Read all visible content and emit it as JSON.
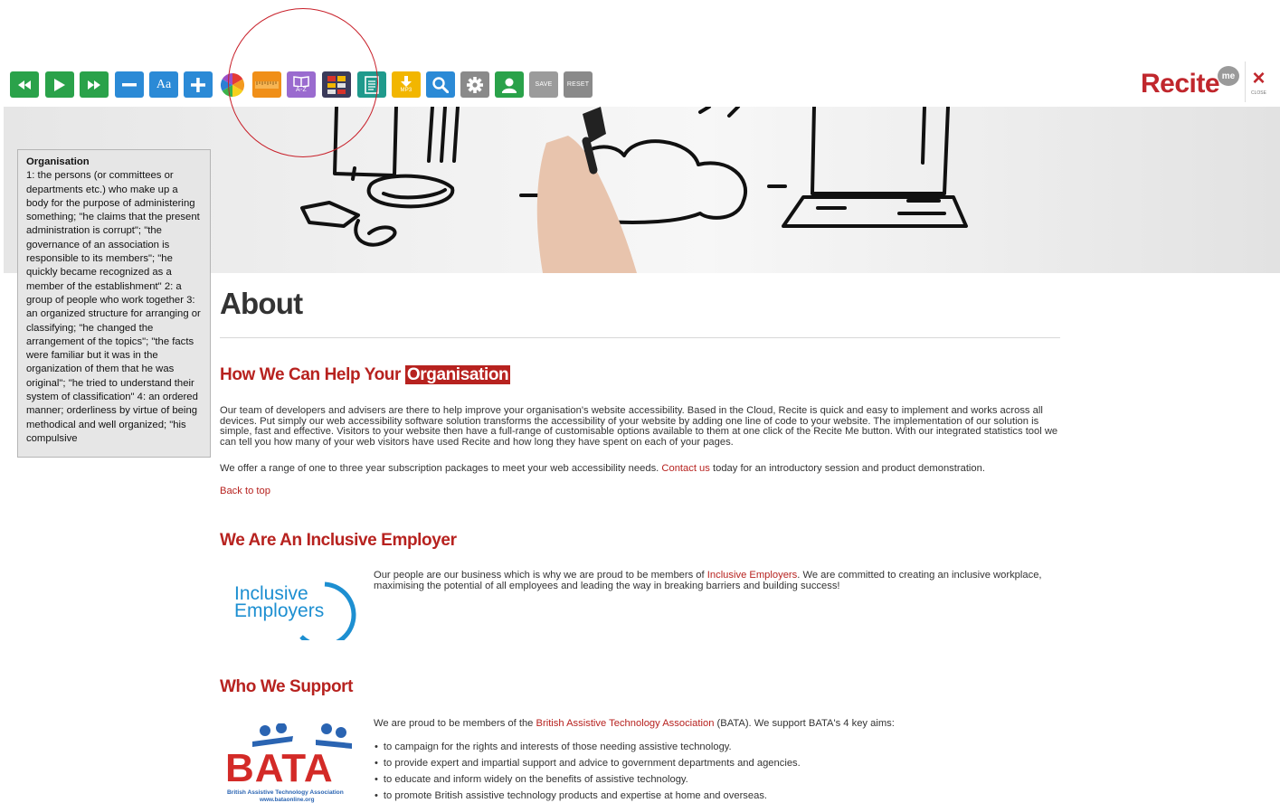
{
  "toolbar": {
    "buttons": [
      {
        "name": "rewind-button",
        "icon": "rewind-icon",
        "color": "#2aa24a"
      },
      {
        "name": "play-button",
        "icon": "play-icon",
        "color": "#2aa24a"
      },
      {
        "name": "fast-forward-button",
        "icon": "fast-forward-icon",
        "color": "#2aa24a"
      },
      {
        "name": "decrease-text-button",
        "icon": "minus-icon",
        "color": "#2b8ad6"
      },
      {
        "name": "font-button",
        "icon": "font-icon",
        "label": "Aa",
        "color": "#2b8ad6"
      },
      {
        "name": "increase-text-button",
        "icon": "plus-icon",
        "color": "#2b8ad6"
      },
      {
        "name": "color-button",
        "icon": "color-wheel-icon",
        "color": "#ffffff"
      },
      {
        "name": "ruler-button",
        "icon": "ruler-icon",
        "color": "#f08f18"
      },
      {
        "name": "dictionary-button",
        "icon": "dictionary-icon",
        "label": "A-Z",
        "color": "#9a6bcf"
      },
      {
        "name": "translate-button",
        "icon": "flags-icon",
        "color": "#3b3b5a"
      },
      {
        "name": "text-only-button",
        "icon": "document-icon",
        "color": "#1f9a8c"
      },
      {
        "name": "download-mp3-button",
        "icon": "download-icon",
        "label": "MP3",
        "color": "#f2b600"
      },
      {
        "name": "magnifier-button",
        "icon": "magnifier-icon",
        "color": "#2b8ad6"
      },
      {
        "name": "settings-button",
        "icon": "gear-icon",
        "color": "#8a8a8a"
      },
      {
        "name": "user-button",
        "icon": "user-icon",
        "color": "#2aa24a"
      },
      {
        "name": "save-button",
        "icon": "save-icon",
        "label": "SAVE",
        "color": "#9b9b9b"
      },
      {
        "name": "reset-button",
        "icon": "reset-icon",
        "label": "RESET",
        "color": "#8a8a8a"
      }
    ],
    "logo": "Recite",
    "logo_badge": "me",
    "close_symbol": "×",
    "close_label": "CLOSE",
    "accent": "#c0272d"
  },
  "dictionary": {
    "term": "Organisation",
    "definition": "1: the persons (or committees or departments etc.) who make up a body for the purpose of administering something; \"he claims that the present administration is corrupt\"; \"the governance of an association is responsible to its members\"; \"he quickly became recognized as a member of the establishment\" 2: a group of people who work together 3: an organized structure for arranging or classifying; \"he changed the arrangement of the topics\"; \"the facts were familiar but it was in the organization of them that he was original\"; \"he tried to understand their system of classification\" 4: an ordered manner; orderliness by virtue of being methodical and well organized; \"his compulsive"
  },
  "page": {
    "title": "About",
    "help": {
      "heading_prefix": "How We Can Help Your ",
      "heading_highlight": "Organisation",
      "body": "Our team of developers and advisers are there to help improve your organisation's website accessibility. Based in the Cloud, Recite is quick and easy to implement and works across all devices. Put simply our web accessibility software solution transforms the accessibility of your website by adding one line of code to your website. The implementation of our solution is simple, fast and effective. Visitors to your website then have a full-range of customisable options available to them at one click of the Recite Me button. With our integrated statistics tool we can tell you how many of your web visitors have used Recite and how long they have spent on each of your pages.",
      "offer_before": "We offer a range of one to three year subscription packages to meet your web accessibility needs. ",
      "offer_link": "Contact us",
      "offer_after": " today for an introductory session and product demonstration.",
      "back_to_top": "Back to top"
    },
    "employer": {
      "heading": "We Are An Inclusive Employer",
      "logo_line1": "Inclusive",
      "logo_line2": "Employers",
      "text_before": "Our people are our business which is why we are proud to be members of ",
      "text_link": "Inclusive Employers",
      "text_after": ". We are committed to creating an inclusive workplace, maximising the potential of all employees and leading the way in breaking barriers and building success!"
    },
    "support": {
      "heading": "Who We Support",
      "logo_letters": "BATA",
      "logo_caption": "British Assistive Technology Association",
      "logo_url": "www.bataonline.org",
      "intro_before": "We are proud to be members of the ",
      "intro_link": "British Assistive Technology Association",
      "intro_after": " (BATA). We support BATA's 4 key aims:",
      "aims": [
        "to campaign for the rights and interests of those needing assistive technology.",
        "to provide expert and impartial support and advice to government departments and agencies.",
        "to educate and inform widely on the benefits of assistive technology.",
        "to promote British assistive technology products and expertise at home and overseas."
      ]
    },
    "brand_red": "#b7221f"
  }
}
